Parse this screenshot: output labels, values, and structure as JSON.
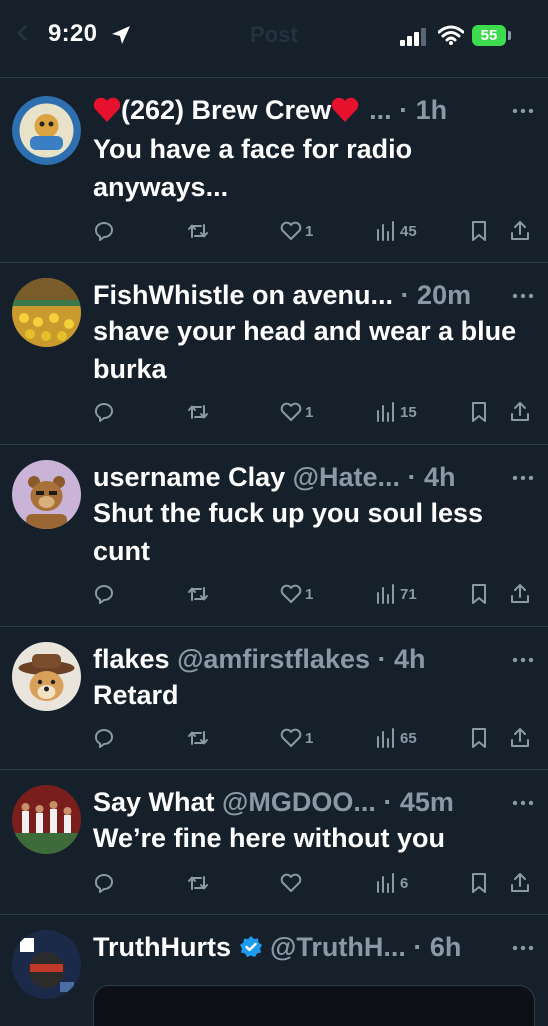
{
  "status_bar": {
    "time": "9:20",
    "ghost_title": "Post",
    "battery": "55"
  },
  "tweets": [
    {
      "name": "(262) Brew Crew",
      "handle": "",
      "ellipsis": "...",
      "time": "1h",
      "text": "You have a face for radio anyways...",
      "replies": "",
      "retweets": "",
      "likes": "1",
      "views": "45"
    },
    {
      "name": "FishWhistle on avenu...",
      "handle": "",
      "ellipsis": "",
      "time": "20m",
      "text": "shave your head and wear a blue burka",
      "replies": "",
      "retweets": "",
      "likes": "1",
      "views": "15"
    },
    {
      "name": "username Clay",
      "handle": "@Hate...",
      "ellipsis": "",
      "time": "4h",
      "text": "Shut the fuck up you soul less cunt",
      "replies": "",
      "retweets": "",
      "likes": "1",
      "views": "71"
    },
    {
      "name": "flakes",
      "handle": "@amfirstflakes",
      "ellipsis": "",
      "time": "4h",
      "text": "Retard",
      "replies": "",
      "retweets": "",
      "likes": "1",
      "views": "65"
    },
    {
      "name": "Say What",
      "handle": "@MGDOO...",
      "ellipsis": "",
      "time": "45m",
      "text": "We’re fine here without you",
      "replies": "",
      "retweets": "",
      "likes": "",
      "views": "6"
    },
    {
      "name": "TruthHurts",
      "handle": "@TruthH...",
      "ellipsis": "",
      "time": "6h",
      "text": ""
    }
  ],
  "colors": {
    "background": "#15202b",
    "muted": "#8b98a5",
    "divider": "#2f3b47",
    "verified": "#1d9bf0",
    "battery": "#3ddc4f"
  }
}
